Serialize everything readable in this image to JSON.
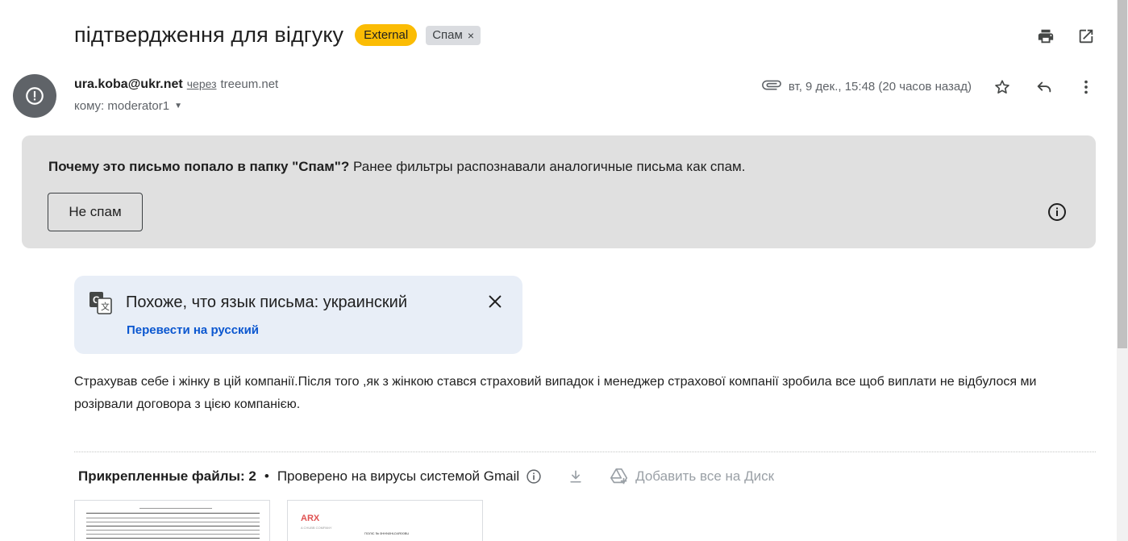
{
  "subject": {
    "title": "підтвердження для відгуку",
    "labels": {
      "external": "External",
      "spam": "Спам"
    },
    "spam_remove": "×"
  },
  "sender": {
    "email": "ura.koba@ukr.net",
    "via": "через",
    "via_domain": "treeum.net",
    "to": "кому: moderator1",
    "date": "вт, 9 дек., 15:48 (20 часов назад)"
  },
  "spam_notice": {
    "question": "Почему это письмо попало в папку \"Спам\"?",
    "reason": "Ранее фильтры распознавали аналогичные письма как спам.",
    "not_spam_button": "Не спам"
  },
  "translate": {
    "text": "Похоже, что язык письма: украинский",
    "link": "Перевести на русский"
  },
  "body": {
    "text": "Страхував себе і жінку в цій компанії.Після того ,як з жінкою стався страховий випадок і менеджер страхової компанії зробила все щоб виплати не відбулося ми розірвали договора з цією компанією."
  },
  "attachments": {
    "title": "Прикрепленные файлы: 2",
    "bullet": "•",
    "scanned": "Проверено на вирусы системой Gmail",
    "add_to_drive": "Добавить все на Диск",
    "thumb2_logo": "ARX",
    "thumb2_sub": "A CHUBB COMPANY",
    "thumb2_doc": "ПОЛІС № 0ННN0HLD4R00BU"
  },
  "icons": {
    "print": "printer-icon",
    "open_new": "open-in-new-window-icon",
    "avatar": "warning-circle-icon",
    "attachment": "paperclip-icon",
    "star": "star-icon",
    "reply": "reply-icon",
    "more": "more-vertical-icon",
    "info": "info-icon",
    "translate": "translate-icon",
    "close": "close-icon",
    "download": "download-icon",
    "drive": "drive-add-icon"
  },
  "colors": {
    "external_badge": "#fbbc04",
    "spam_notice_bg": "#e0e0e0",
    "translate_bg": "#e8eef7",
    "link": "#0b57d0"
  }
}
